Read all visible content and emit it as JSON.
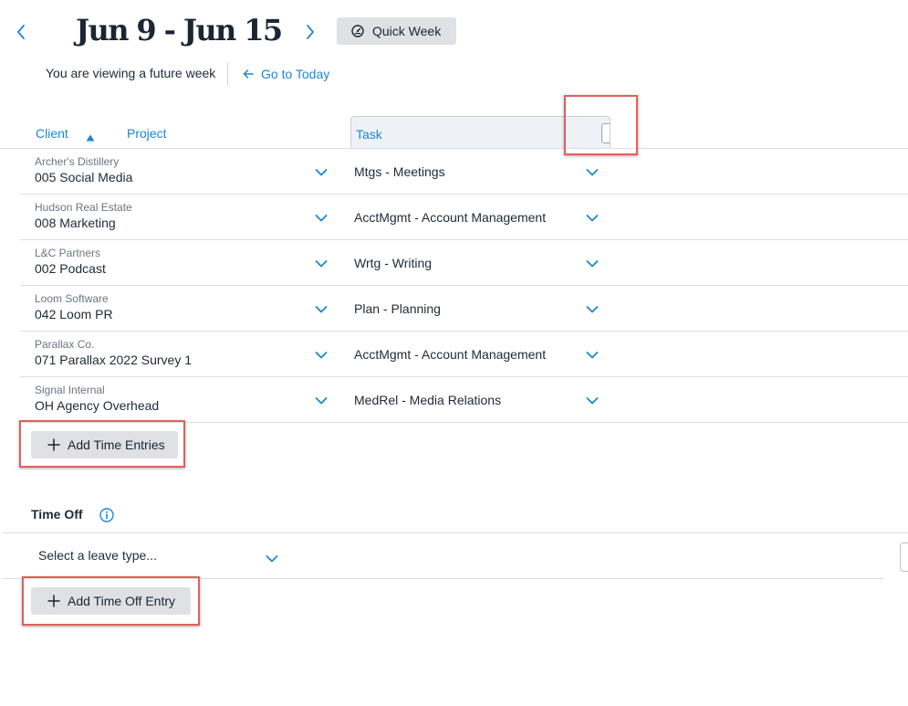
{
  "header": {
    "week_range": "Jun 9 - Jun 15",
    "quick_week_label": "Quick Week",
    "future_notice": "You are viewing a future week",
    "go_to_today_label": "Go to Today"
  },
  "columns": {
    "client": "Client",
    "project": "Project",
    "task": "Task",
    "client_sort": "ascending"
  },
  "rows": [
    {
      "client": "Archer's Distillery",
      "project": "005 Social Media",
      "task": "Mtgs - Meetings"
    },
    {
      "client": "Hudson Real Estate",
      "project": "008 Marketing",
      "task": "AcctMgmt - Account Management"
    },
    {
      "client": "L&C Partners",
      "project": "002 Podcast",
      "task": "Wrtg - Writing"
    },
    {
      "client": "Loom Software",
      "project": "042 Loom PR",
      "task": "Plan - Planning"
    },
    {
      "client": "Parallax Co.",
      "project": "071 Parallax 2022 Survey 1",
      "task": "AcctMgmt - Account Management"
    },
    {
      "client": "Signal Internal",
      "project": "OH Agency Overhead",
      "task": "MedRel - Media Relations"
    }
  ],
  "actions": {
    "add_time_entries": "Add Time Entries",
    "add_time_off_entry": "Add Time Off Entry"
  },
  "time_off": {
    "title": "Time Off",
    "leave_type_placeholder": "Select a leave type..."
  },
  "icons": {
    "prev": "chevron-left-icon",
    "next": "chevron-right-icon",
    "quick_week": "gauge-icon",
    "go_today": "arrow-left-icon",
    "sort": "triangle-up-icon",
    "row_dropdown": "chevron-down-icon",
    "add": "plus-icon",
    "info": "info-circle-icon"
  },
  "colors": {
    "accent": "#1c86d6",
    "button_bg": "#dfe1e4",
    "highlight": "#e0615d"
  }
}
